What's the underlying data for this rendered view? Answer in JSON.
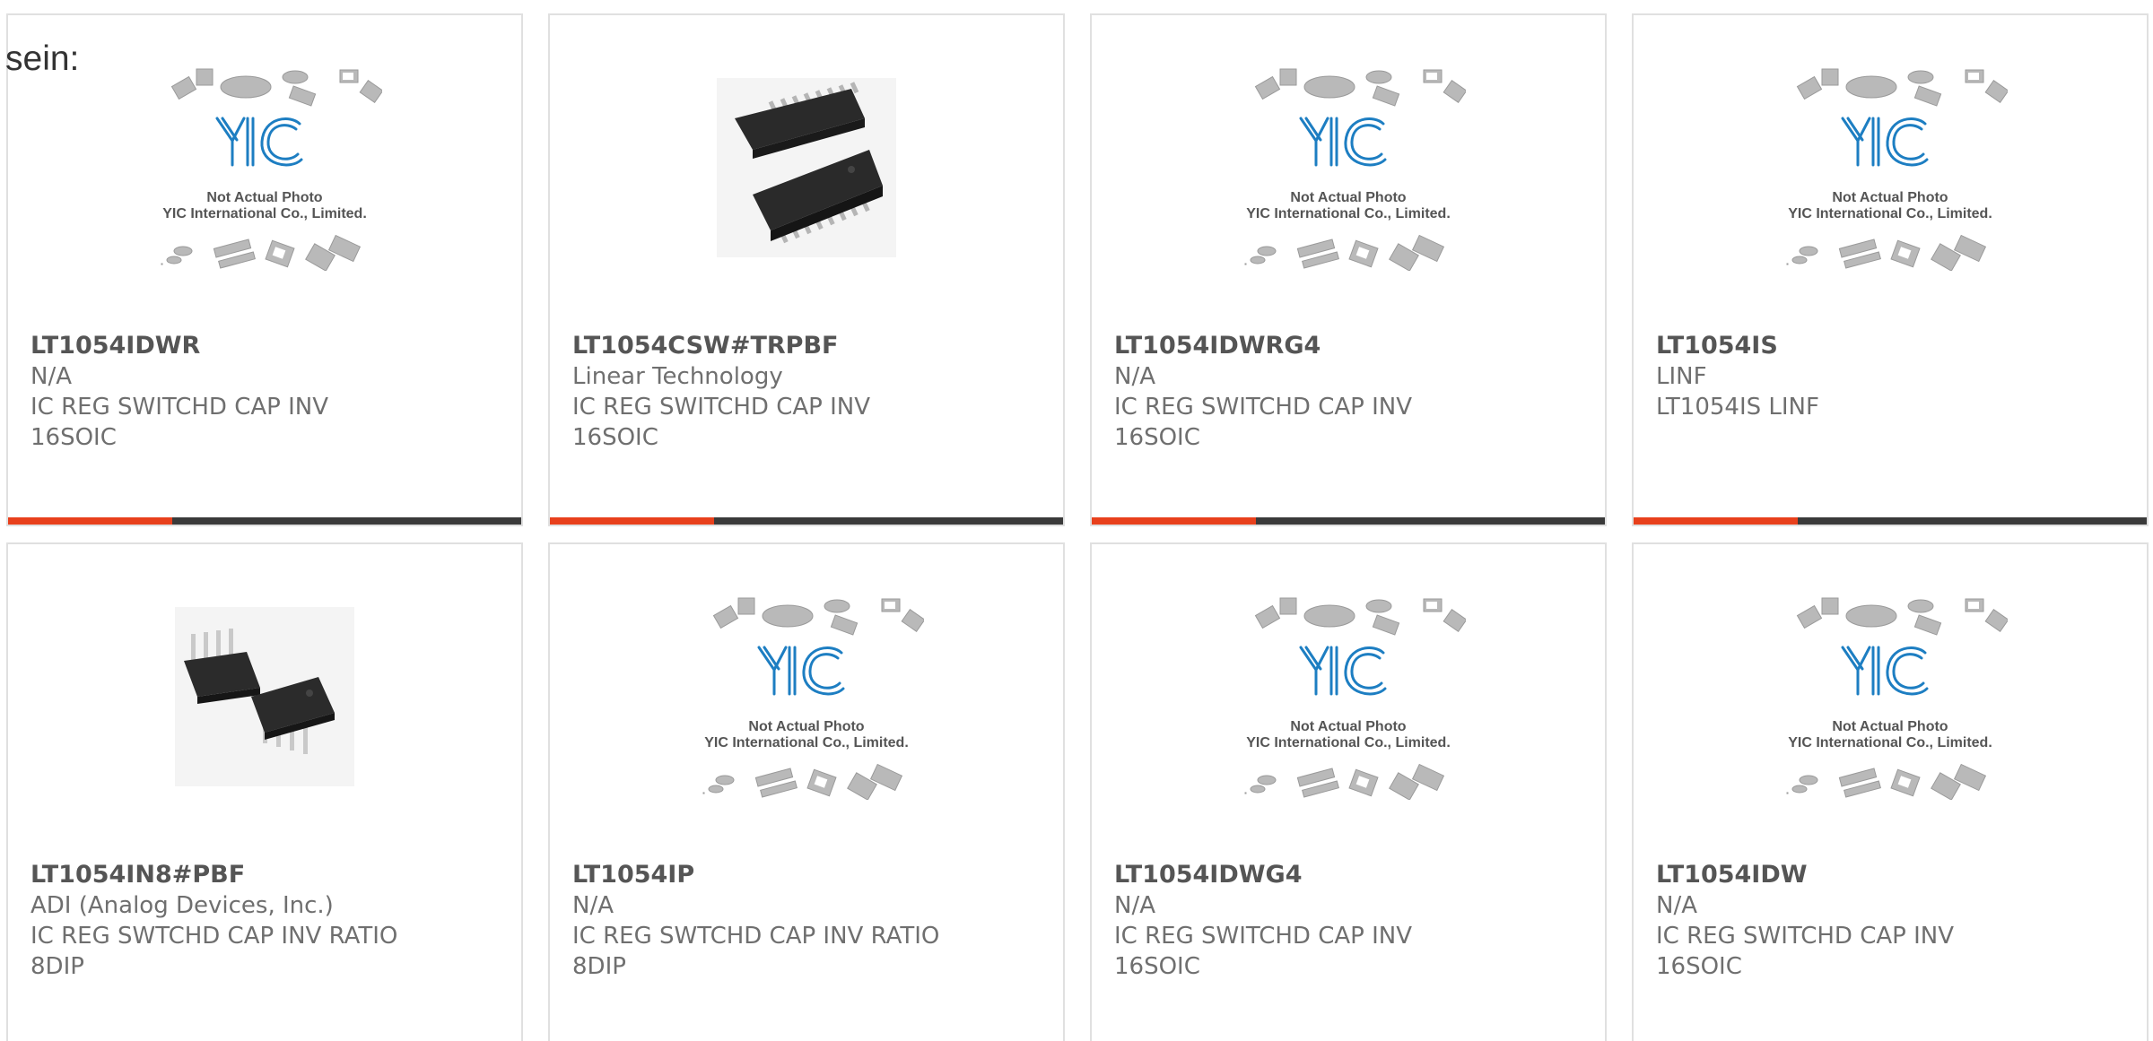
{
  "intro_text": "sein:",
  "placeholder": {
    "line1": "Not Actual Photo",
    "line2": "YIC International Co., Limited."
  },
  "colors": {
    "accent": "#e8401c",
    "bar": "#3a3a3a",
    "logo_blue": "#1d7ec2"
  },
  "products": [
    {
      "part": "LT1054IDWR",
      "maker": "N/A",
      "desc": "IC REG SWITCHD CAP INV",
      "pkg": "16SOIC",
      "image": "placeholder"
    },
    {
      "part": "LT1054CSW#TRPBF",
      "maker": "Linear Technology",
      "desc": "IC REG SWITCHD CAP INV",
      "pkg": "16SOIC",
      "image": "soic-chip-photo"
    },
    {
      "part": "LT1054IDWRG4",
      "maker": "N/A",
      "desc": "IC REG SWITCHD CAP INV",
      "pkg": "16SOIC",
      "image": "placeholder"
    },
    {
      "part": "LT1054IS",
      "maker": "LINF",
      "desc": "LT1054IS LINF",
      "pkg": "",
      "image": "placeholder"
    },
    {
      "part": "LT1054IN8#PBF",
      "maker": "ADI (Analog Devices, Inc.)",
      "desc": "IC REG SWTCHD CAP INV RATIO",
      "pkg": "8DIP",
      "image": "dip-chip-photo"
    },
    {
      "part": "LT1054IP",
      "maker": "N/A",
      "desc": "IC REG SWTCHD CAP INV RATIO",
      "pkg": "8DIP",
      "image": "placeholder"
    },
    {
      "part": "LT1054IDWG4",
      "maker": "N/A",
      "desc": "IC REG SWITCHD CAP INV",
      "pkg": "16SOIC",
      "image": "placeholder"
    },
    {
      "part": "LT1054IDW",
      "maker": "N/A",
      "desc": "IC REG SWITCHD CAP INV",
      "pkg": "16SOIC",
      "image": "placeholder"
    }
  ]
}
